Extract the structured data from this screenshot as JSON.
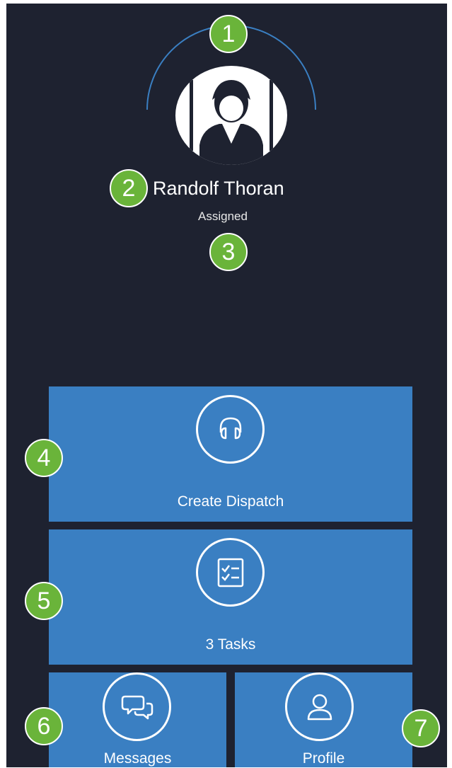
{
  "user": {
    "name": "Randolf Thoran",
    "status": "Assigned"
  },
  "tiles": {
    "create_dispatch": {
      "label": "Create Dispatch",
      "icon": "headset-icon"
    },
    "tasks": {
      "label": "3 Tasks",
      "icon": "checklist-icon"
    },
    "messages": {
      "label": "Messages",
      "icon": "chat-bubbles-icon"
    },
    "profile": {
      "label": "Profile",
      "icon": "person-icon"
    }
  },
  "callouts": [
    "1",
    "2",
    "3",
    "4",
    "5",
    "6",
    "7"
  ],
  "colors": {
    "background": "#1e2230",
    "tile": "#3a7fc2",
    "callout": "#6ab43a",
    "arc": "#3a7fc2"
  }
}
